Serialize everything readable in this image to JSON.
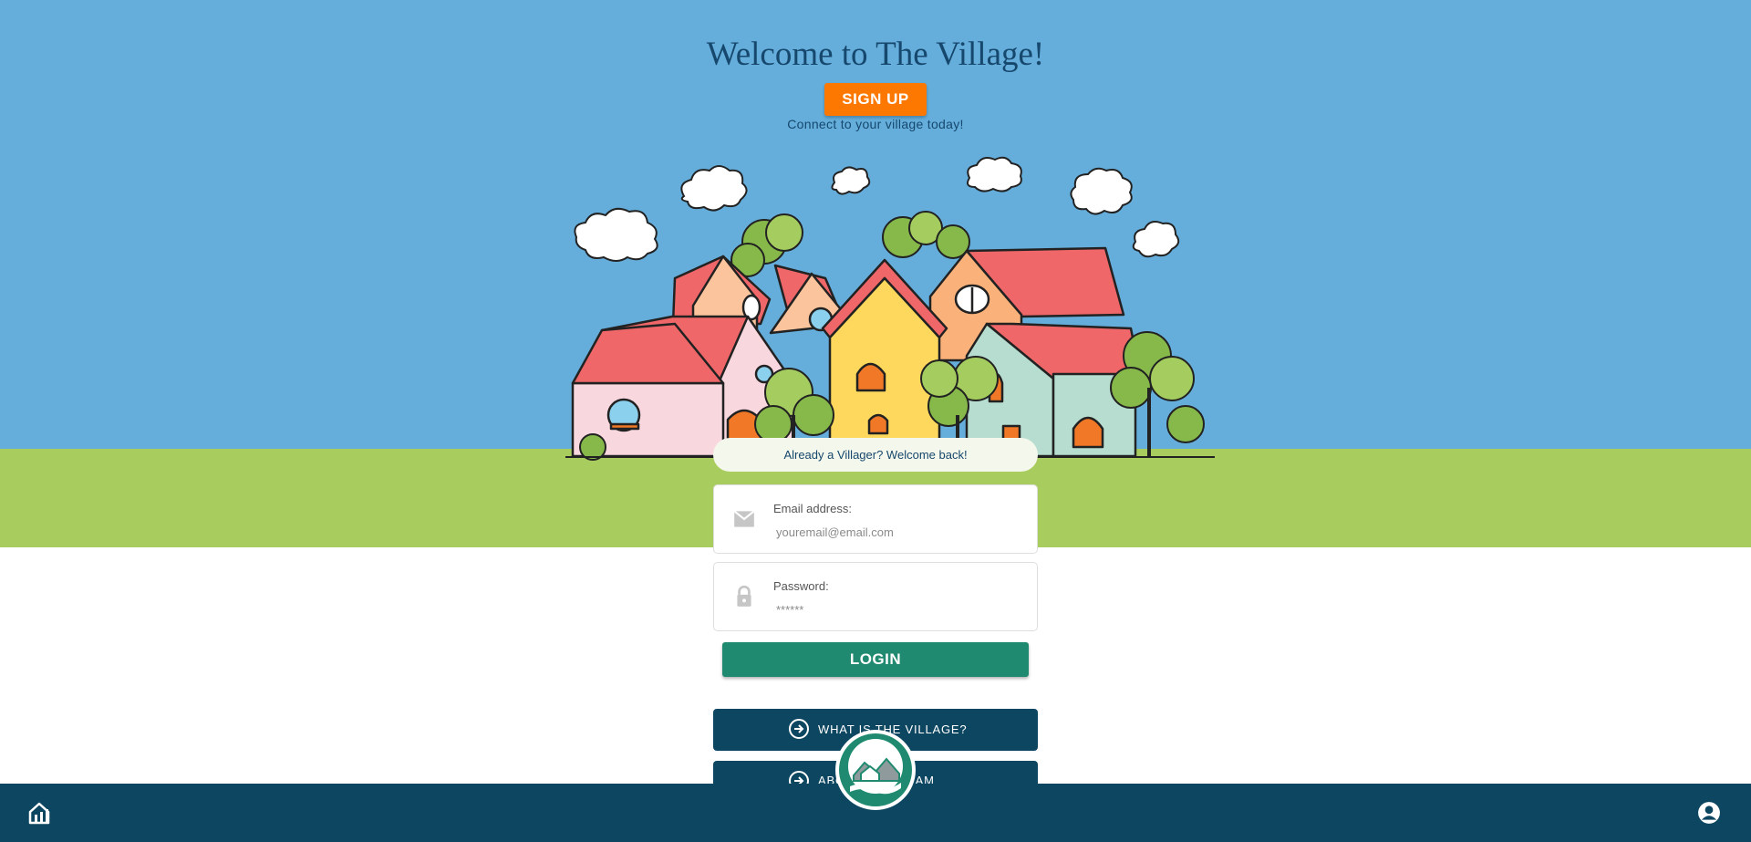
{
  "hero": {
    "title": "Welcome to The Village!",
    "signup_label": "SIGN UP",
    "tagline": "Connect to your village today!"
  },
  "login_form": {
    "welcome_back": "Already a Villager? Welcome back!",
    "email_label": "Email address:",
    "email_placeholder": "youremail@email.com",
    "password_label": "Password:",
    "password_placeholder": "******",
    "login_label": "LOGIN"
  },
  "links": [
    {
      "label": "WHAT IS THE VILLAGE?",
      "icon": "arrow-circle-right-icon"
    },
    {
      "label": "ABOUT OUR TEAM",
      "icon": "arrow-circle-right-icon"
    }
  ],
  "footer": {
    "home_icon": "home-icon",
    "account_icon": "account-circle-icon",
    "logo_icon": "village-logo"
  },
  "colors": {
    "sky": "#65aedc",
    "grass": "#a9cc5f",
    "title": "#16476c",
    "signup": "#fd7800",
    "login": "#1f8a6f",
    "navy": "#0d4660"
  }
}
